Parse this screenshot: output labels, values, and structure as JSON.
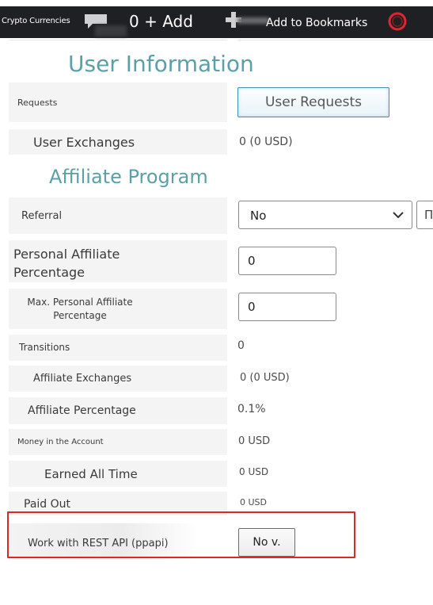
{
  "topbar": {
    "crypto_label": "Crypto Currencies",
    "add_label": "0 + Add",
    "bookmarks_label": "Add to Bookmarks",
    "icons": [
      "chat-icon",
      "plus-icon",
      "opera-icon"
    ],
    "accent_color": "#e0262d"
  },
  "user_info": {
    "title": "User Information",
    "requests_label": "Requests",
    "requests_button": "User Requests",
    "exchanges_label": "User Exchanges",
    "exchanges_value": "0 (0 USD)"
  },
  "affiliate": {
    "title": "Affiliate Program",
    "referral_label": "Referral",
    "referral_selected": "No",
    "referral_extra": "П",
    "personal_pct_label": "Personal Affiliate Percentage",
    "personal_pct_value": "0",
    "max_pct_label": "Max. Personal Affiliate Percentage",
    "max_pct_value": "0",
    "transitions_label": "Transitions",
    "transitions_value": "0",
    "aff_exchanges_label": "Affiliate Exchanges",
    "aff_exchanges_value": "0 (0 USD)",
    "aff_pct_label": "Affiliate Percentage",
    "aff_pct_value": "0.1%",
    "money_label": "Money in the Account",
    "money_value": "0 USD",
    "earned_label": "Earned All Time",
    "earned_value": "0 USD",
    "paid_label": "Paid Out",
    "paid_value": "0 USD"
  },
  "rest_api": {
    "label": "Work with REST API (ppapi)",
    "button": "No v.",
    "highlight_color": "#d72b2b"
  },
  "colors": {
    "title": "#5aa0a8",
    "button_border": "#3f8fb0"
  }
}
